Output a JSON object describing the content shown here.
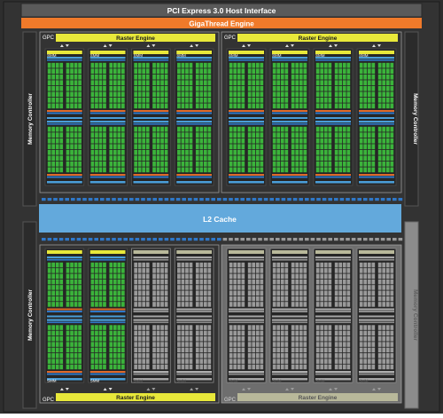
{
  "title_bar": {
    "label": "PCI Express 3.0 Host Interface"
  },
  "gigathread": {
    "label": "GigaThread Engine"
  },
  "l2_cache": {
    "label": "L2 Cache"
  },
  "memory_controller": {
    "label": "Memory Controller",
    "count": 4,
    "inactive": [
      "bottom-right"
    ]
  },
  "gpcs": [
    {
      "label": "GPC",
      "raster_label": "Raster Engine",
      "smm_label": "SMM",
      "smm_count": 4,
      "active_smm_count": 4
    },
    {
      "label": "GPC",
      "raster_label": "Raster Engine",
      "smm_label": "SMM",
      "smm_count": 4,
      "active_smm_count": 4
    },
    {
      "label": "GPC",
      "raster_label": "Raster Engine",
      "smm_label": "SMM",
      "smm_count": 4,
      "active_smm_count": 2
    },
    {
      "label": "GPC",
      "raster_label": "Raster Engine",
      "smm_label": "SMM",
      "smm_count": 4,
      "active_smm_count": 0
    }
  ],
  "colors": {
    "background": "#2f2f2f",
    "title_bar": "#555555",
    "gigathread": "#f07a2a",
    "raster_engine": "#e8e83a",
    "l2_cache": "#63a9dc",
    "core": "#3bb43b",
    "dispatch": "#2f78c8",
    "cache_blue": "#4a9ed8",
    "sfu": "#e06a2a",
    "disabled": "#8a8a8a"
  }
}
